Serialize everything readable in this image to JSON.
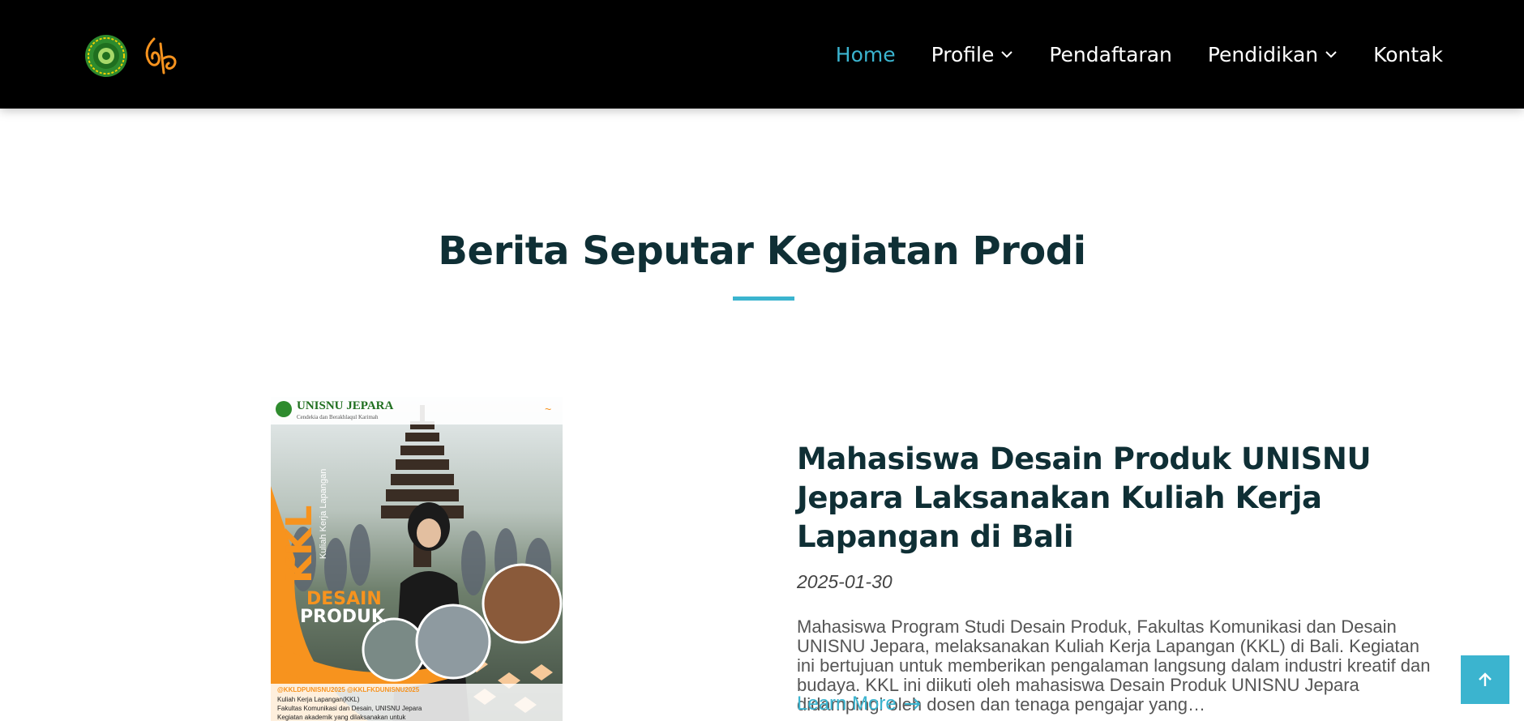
{
  "header": {
    "nav": [
      {
        "label": "Home",
        "active": true,
        "dropdown": false
      },
      {
        "label": "Profile",
        "active": false,
        "dropdown": true
      },
      {
        "label": "Pendaftaran",
        "active": false,
        "dropdown": false
      },
      {
        "label": "Pendidikan",
        "active": false,
        "dropdown": true
      },
      {
        "label": "Kontak",
        "active": false,
        "dropdown": false
      }
    ],
    "accent_color": "#3bb4cf"
  },
  "section": {
    "title": "Berita Seputar Kegiatan Prodi"
  },
  "article": {
    "title": "Mahasiswa Desain Produk UNISNU Jepara Laksanakan Kuliah Kerja Lapangan di Bali",
    "date": "2025-01-30",
    "excerpt": "Mahasiswa Program Studi Desain Produk, Fakultas Komunikasi dan Desain UNISNU Jepara, melaksanakan Kuliah Kerja Lapangan (KKL) di Bali. Kegiatan ini bertujuan untuk memberikan pengalaman langsung dalam industri kreatif dan budaya. KKL ini diikuti oleh mahasiswa Desain Produk UNISNU Jepara didampingi oleh dosen dan tenaga pengajar yang…",
    "learn_more": "Learn More",
    "poster": {
      "brand": "UNISNU JEPARA",
      "tagline": "Cendekia dan Berakhlaqul Karimah",
      "kkl": "KKL",
      "kkl_full": "Kuliah Kerja Lapangan",
      "desain": "DESAIN",
      "produk": "PRODUK",
      "hashtags": "@KKLDPUNISNU2025 @KKLFKDUNISNU2025",
      "caption_1": "Kuliah Kerja Lapangan(KKL)",
      "caption_2": "Fakultas Komunikasi dan Desain, UNISNU Jepara",
      "caption_3": "Kegiatan akademik yang dilaksanakan untuk"
    }
  },
  "icons": {
    "chevron": "chevron-down-icon",
    "arrow": "arrow-right-icon",
    "back_to_top": "arrow-up-icon"
  }
}
